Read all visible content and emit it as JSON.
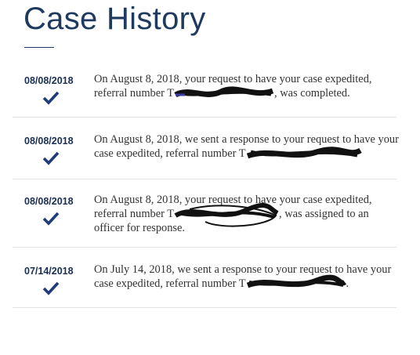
{
  "page": {
    "title": "Case History"
  },
  "entries": [
    {
      "date": "08/08/2018",
      "text_before": "On August 8, 2018, your request to have your case expedited, referral number T",
      "text_after": ", was completed."
    },
    {
      "date": "08/08/2018",
      "text_before": "On August 8, 2018, we sent a response to your request to have your case expedited, referral number T",
      "text_after": ""
    },
    {
      "date": "08/08/2018",
      "text_before": "On August 8, 2018, your request to have your case expedited, referral number T",
      "text_after": ", was assigned to an officer for response."
    },
    {
      "date": "07/14/2018",
      "text_before": "On July 14, 2018, we sent a response to your request to have your case expedited, referral number T",
      "text_after": "."
    }
  ],
  "icons": {
    "status": "checkmark-icon"
  },
  "colors": {
    "title": "#1f3a5f",
    "date": "#1a2f52",
    "check": "#1f3b7a",
    "body_text": "#333333",
    "divider": "#e2e2e2"
  }
}
